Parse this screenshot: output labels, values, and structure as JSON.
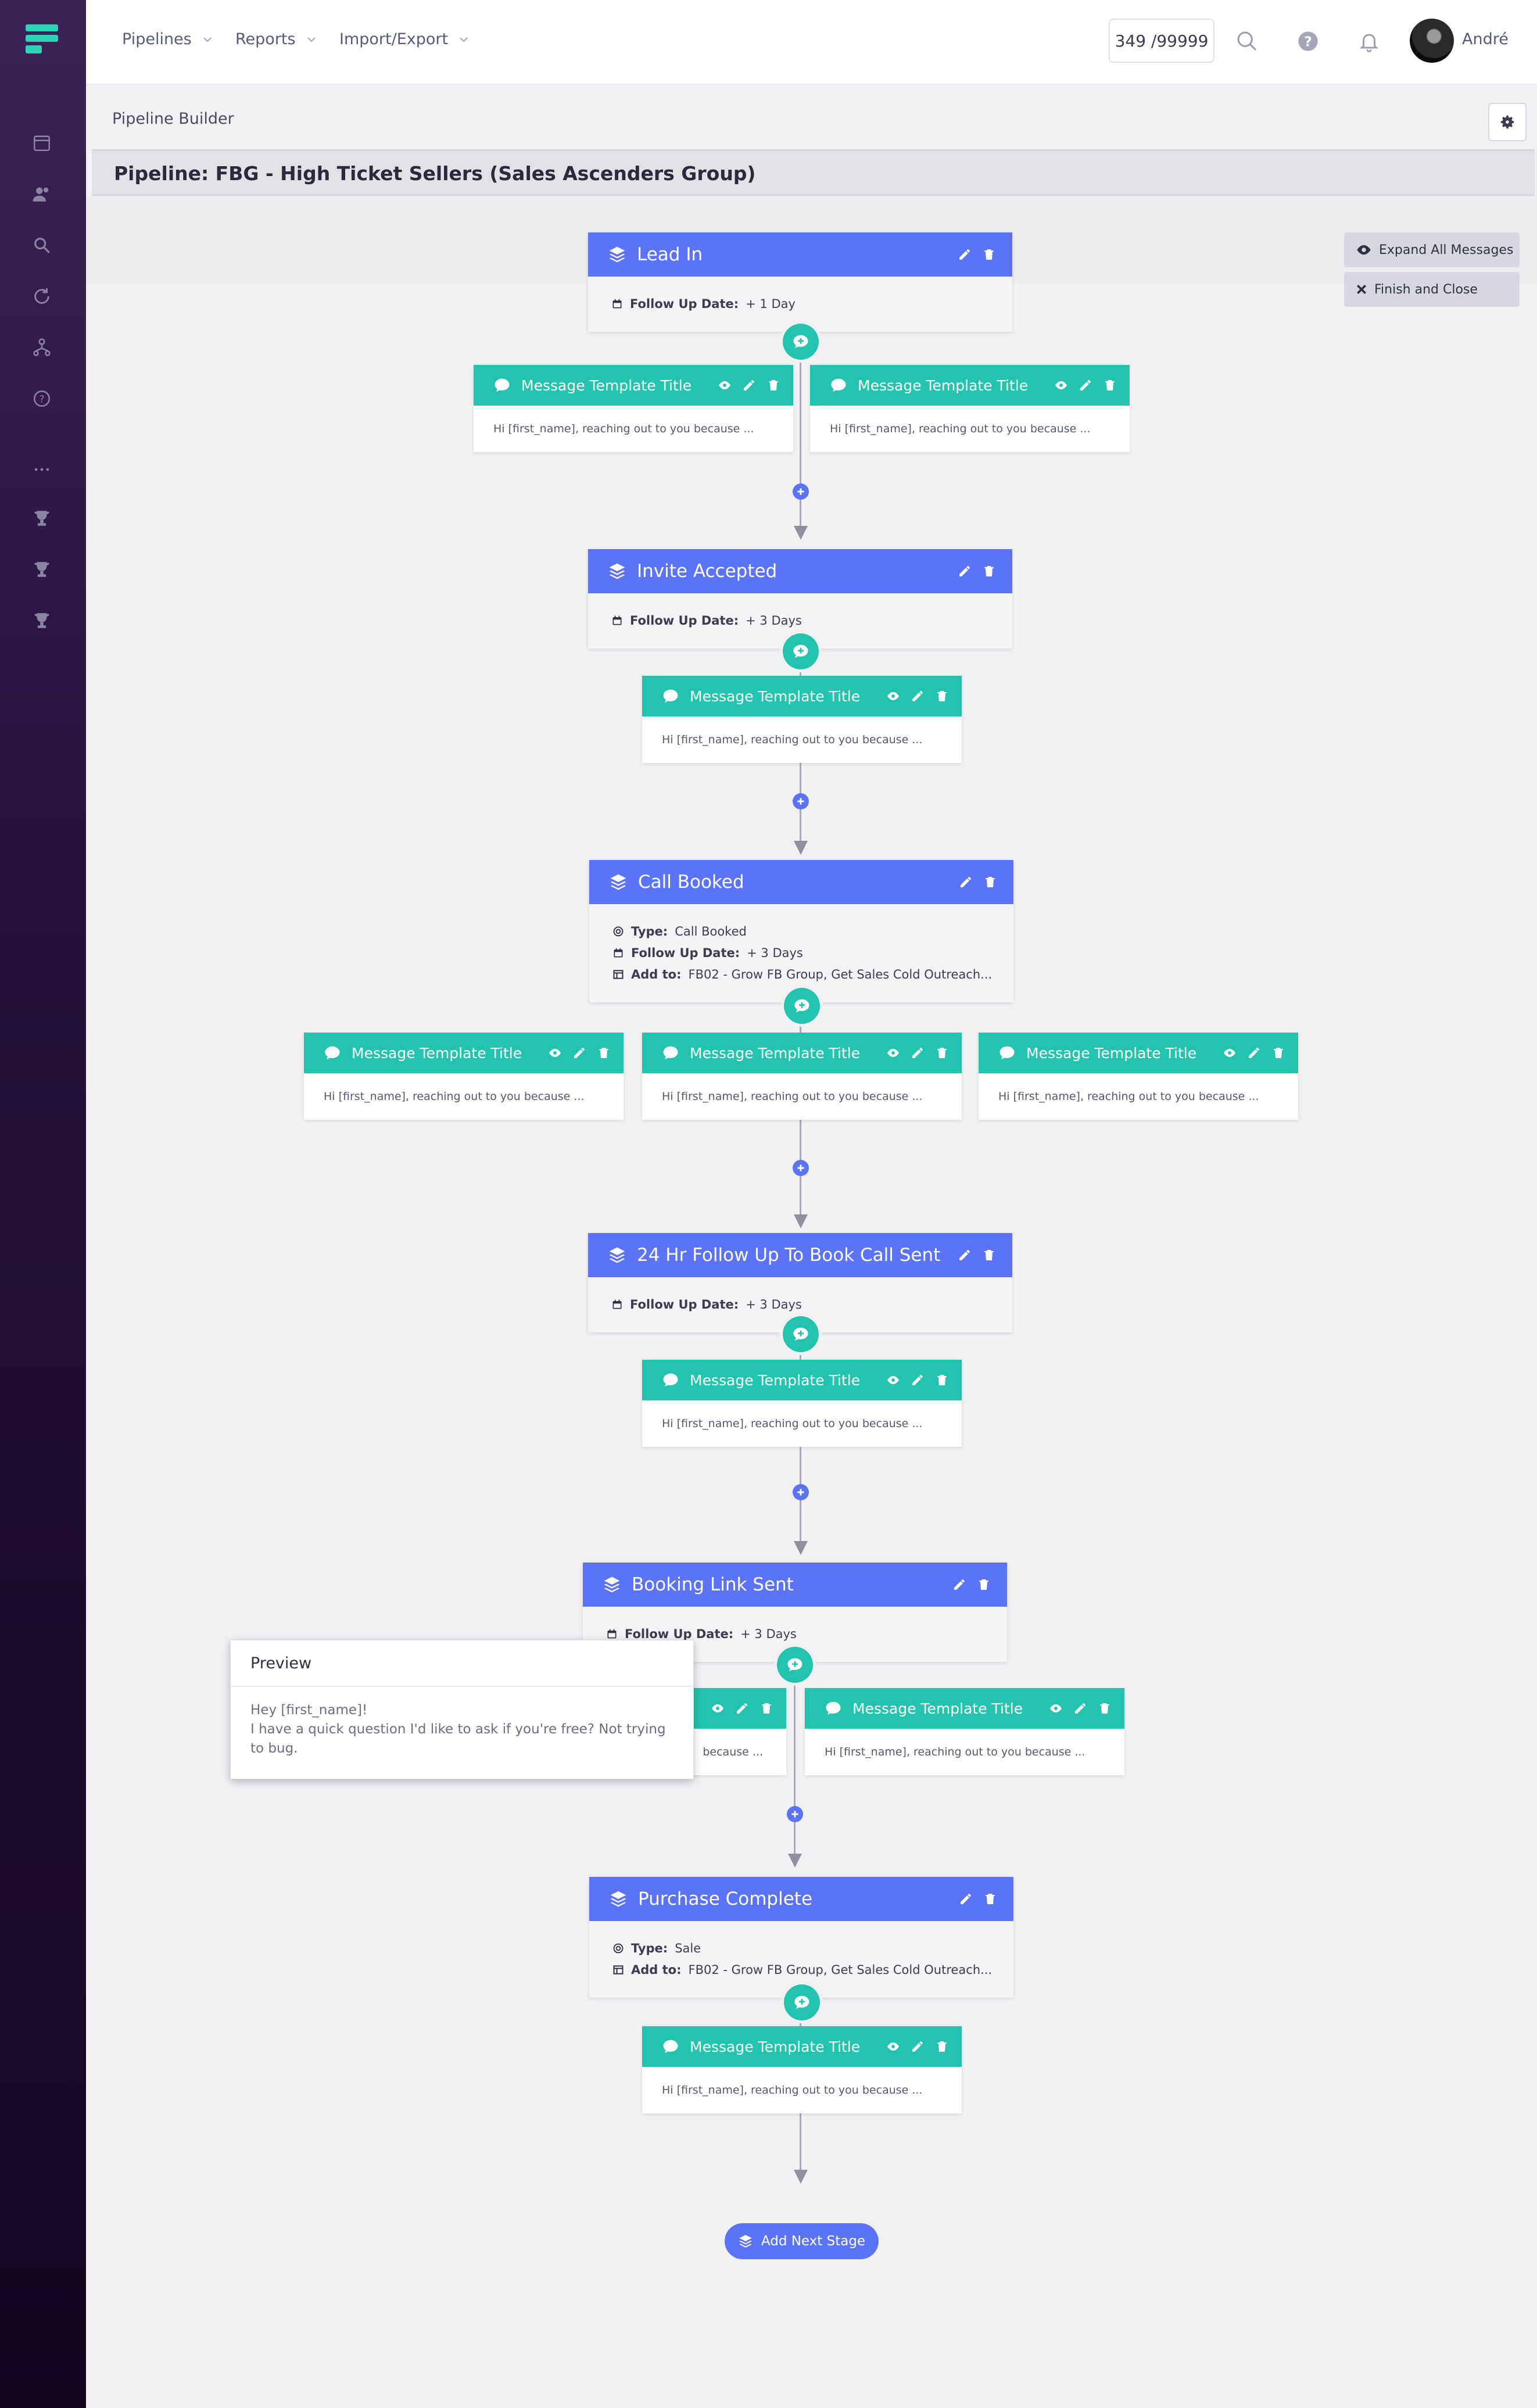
{
  "nav": {
    "items": [
      {
        "label": "Pipelines"
      },
      {
        "label": "Reports"
      },
      {
        "label": "Import/Export"
      }
    ],
    "counter": "349 /99999",
    "user_name": "André"
  },
  "breadcrumb": "Pipeline Builder",
  "pipeline_title": "Pipeline: FBG - High Ticket Sellers (Sales Ascenders Group)",
  "side_actions": {
    "expand": "Expand All Messages",
    "finish": "Finish and Close"
  },
  "labels": {
    "follow_up": "Follow Up Date:",
    "type": "Type:",
    "add_to": "Add to:"
  },
  "stages": [
    {
      "title": "Lead In",
      "follow_up": "+ 1 Day"
    },
    {
      "title": "Invite Accepted",
      "follow_up": "+ 3 Days"
    },
    {
      "title": "Call Booked",
      "type": "Call Booked",
      "follow_up": "+ 3 Days",
      "add_to": "FB02 - Grow FB Group, Get Sales Cold Outreach..."
    },
    {
      "title": "24 Hr Follow Up To Book Call Sent",
      "follow_up": "+ 3 Days"
    },
    {
      "title": "Booking Link Sent",
      "follow_up": "+ 3 Days"
    },
    {
      "title": "Purchase Complete",
      "type": "Sale",
      "add_to": "FB02 - Grow FB Group, Get Sales Cold Outreach..."
    }
  ],
  "message": {
    "title": "Message Template Title",
    "snippet": "Hi [first_name], reaching out to you because ...",
    "snippet_clipped": "because ..."
  },
  "add_next_stage": "Add Next Stage",
  "preview": {
    "title": "Preview",
    "line1": "Hey [first_name]!",
    "line2": "I have a quick question I'd like to ask if you're free? Not trying to bug."
  },
  "colors": {
    "stage_header": "#5b73f6",
    "message_header": "#23c4ae",
    "sidebar_top": "#3a2357",
    "sidebar_bottom": "#14061f"
  }
}
